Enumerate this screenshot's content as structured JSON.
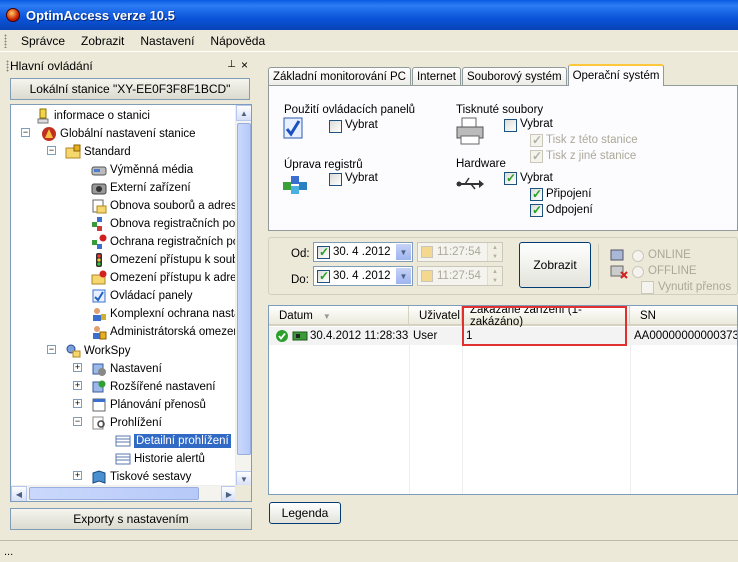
{
  "window": {
    "title": "OptimAccess verze 10.5"
  },
  "menu": [
    "Správce",
    "Zobrazit",
    "Nastavení",
    "Nápověda"
  ],
  "left_panel": {
    "title": "Hlavní ovládání",
    "pin": "⊥",
    "close": "×",
    "station": "Lokální stanice \"XY-EE0F3F8F1BCD\"",
    "export_button": "Exporty s nastavením",
    "tree": {
      "info": "informace o stanici",
      "global": "Globální nastavení stanice",
      "standard": "Standard",
      "removable": "Výměnná média",
      "external": "Externí zařízení",
      "files": "Obnova souborů a adresá",
      "reg_restore": "Obnova registračních polo",
      "reg_protect": "Ochrana registračních pol",
      "file_access": "Omezení přístupu k soubo",
      "dir_access": "Omezení přístupu k adresá",
      "control_panels": "Ovládací panely",
      "complex": "Komplexní ochrana nasta",
      "admin": "Administrátorská omezení",
      "workspy": "WorkSpy",
      "settings": "Nastavení",
      "advanced": "Rozšířené nastavení",
      "scheduled": "Plánování přenosů",
      "browsing": "Prohlížení",
      "detailed": "Detailní prohlížení",
      "alerts": "Historie alertů",
      "print_reports": "Tiskové sestavy"
    }
  },
  "tabs": [
    "Základní monitorování PC",
    "Internet",
    "Souborový systém",
    "Operační systém"
  ],
  "active_tab": "Operační systém",
  "os_tab": {
    "control_panels_label": "Použití ovládacích panelů",
    "control_panels_check": "Vybrat",
    "registry_label": "Úprava registrů",
    "registry_check": "Vybrat",
    "printed_label": "Tisknuté soubory",
    "printed_check": "Vybrat",
    "print_this": "Tisk z této stanice",
    "print_other": "Tisk z jiné stanice",
    "hardware_label": "Hardware",
    "hardware_check": "Vybrat",
    "connect": "Připojení",
    "disconnect": "Odpojení"
  },
  "date_filter": {
    "from_label": "Od:",
    "to_label": "Do:",
    "from_date": "30. 4 .2012",
    "to_date": "30. 4 .2012",
    "from_time": "11:27:54",
    "to_time": "11:27:54",
    "show_button": "Zobrazit",
    "online": "ONLINE",
    "offline": "OFFLINE",
    "force_transfer": "Vynutit přenos"
  },
  "grid": {
    "columns": [
      "Datum",
      "Uživatel",
      "Zakázané zařízení (1-zakázáno)",
      "SN"
    ],
    "rows": [
      {
        "date": "30.4.2012 11:28:33",
        "user": "User",
        "blocked": "1",
        "sn": "AA00000000000373"
      }
    ]
  },
  "legend_button": "Legenda",
  "status": "..."
}
